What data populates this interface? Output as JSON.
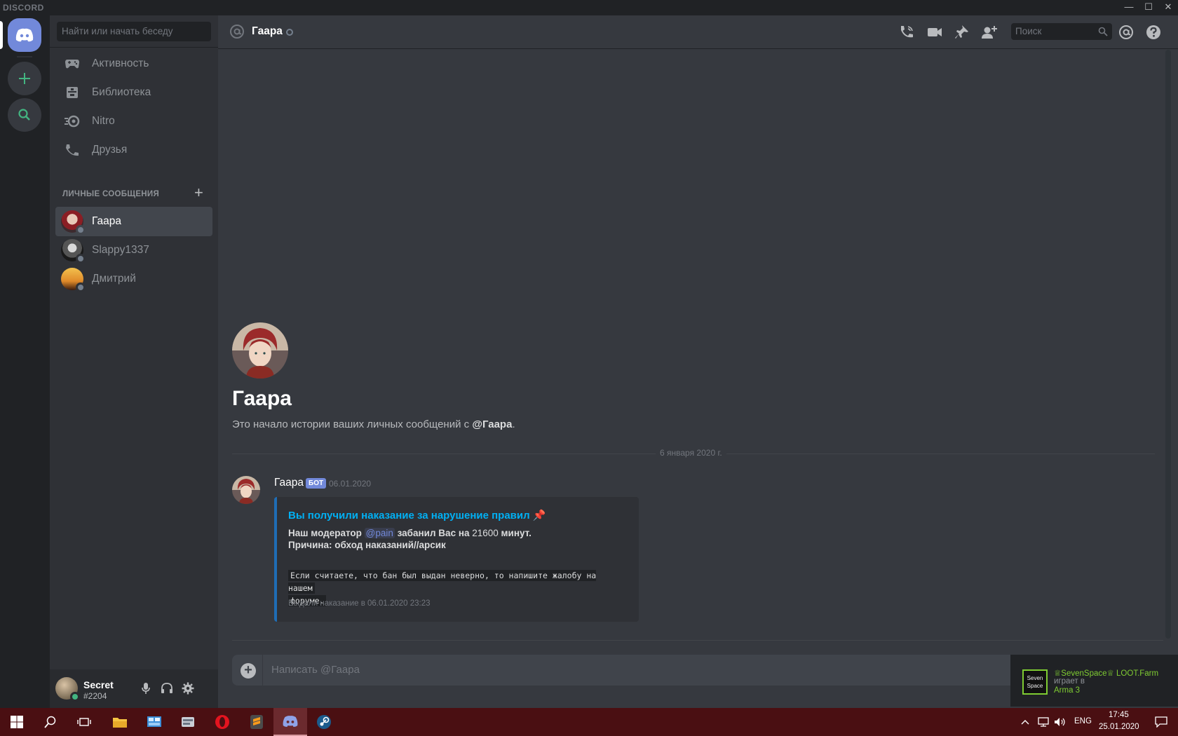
{
  "app": {
    "title": "DISCORD"
  },
  "window_controls": {
    "minimize": "—",
    "maximize": "☐",
    "close": "✕"
  },
  "sidebar": {
    "search_placeholder": "Найти или начать беседу",
    "nav": [
      {
        "label": "Активность",
        "icon": "controller-icon"
      },
      {
        "label": "Библиотека",
        "icon": "library-icon"
      },
      {
        "label": "Nitro",
        "icon": "nitro-icon"
      },
      {
        "label": "Друзья",
        "icon": "friends-icon"
      }
    ],
    "dm_header": "ЛИЧНЫЕ СООБЩЕНИЯ",
    "dm_add": "+",
    "dms": [
      {
        "name": "Гаара",
        "active": true
      },
      {
        "name": "Slappy1337",
        "active": false
      },
      {
        "name": "Дмитрий",
        "active": false
      }
    ]
  },
  "user": {
    "name": "Secret",
    "tag": "#2204"
  },
  "header": {
    "channel_name": "Гаара",
    "search_placeholder": "Поиск"
  },
  "intro": {
    "name": "Гаара",
    "desc_prefix": "Это начало истории ваших личных сообщений с ",
    "desc_mention": "@Гаара",
    "desc_suffix": "."
  },
  "divider": {
    "label": "6 января 2020 г."
  },
  "message": {
    "author": "Гаара",
    "bot_tag": "БОТ",
    "timestamp": "06.01.2020",
    "embed": {
      "title": "Вы получили наказание за нарушение правил",
      "title_emoji": "📌",
      "line1_a": "Наш модератор ",
      "line1_mention": "@pain",
      "line1_b": " забанил Вас на ",
      "line1_num": "21600",
      "line1_c": " минут.",
      "line2": "Причина: обход наказаний//арсик",
      "code_line1": "Если считаете, что бан был выдан неверно, то напишите жалобу на нашем",
      "code_line2": "форуме.",
      "footer": "Выдали наказание в 06.01.2020 23:23"
    }
  },
  "composer": {
    "placeholder": "Написать @Гаара"
  },
  "notification": {
    "line1": "♕SevenSpace♕ LOOT.Farm",
    "line2": "играет в",
    "line3": "Arma 3",
    "logo_text": "Seven Space"
  },
  "taskbar": {
    "lang": "ENG",
    "time": "17:45",
    "date": "25.01.2020"
  },
  "colors": {
    "accent": "#7289da",
    "link": "#00b0f4",
    "online": "#43b581",
    "taskbar": "#4a0f12"
  }
}
